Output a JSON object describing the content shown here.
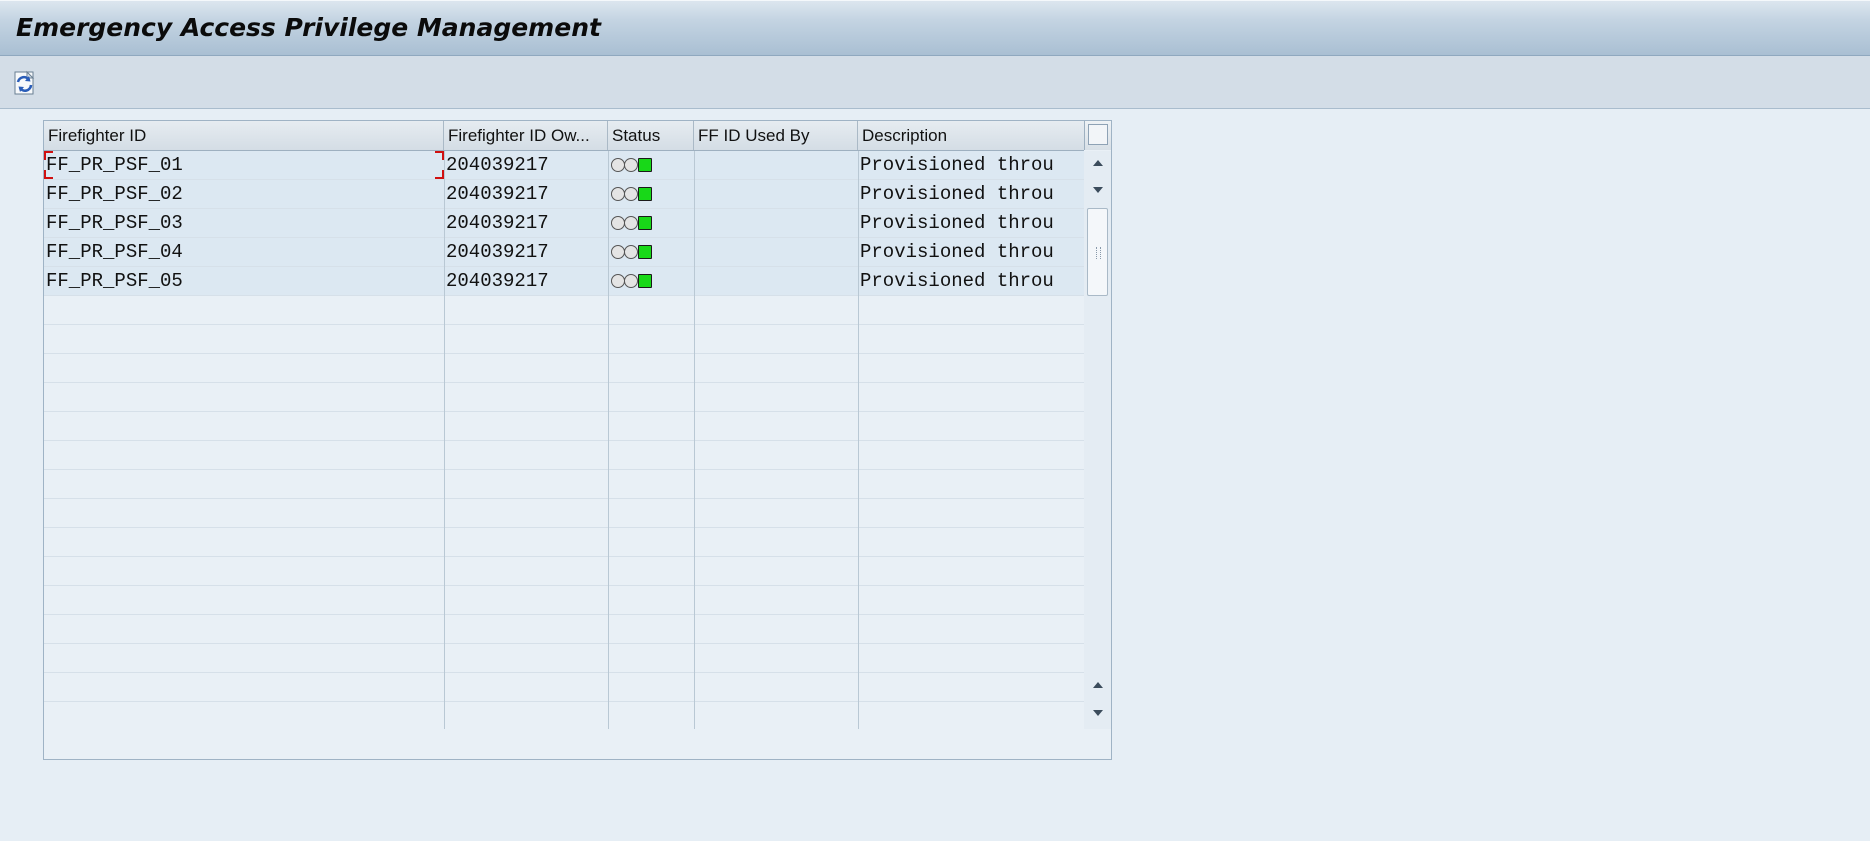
{
  "app": {
    "title": "Emergency Access Privilege Management"
  },
  "toolbar": {
    "refresh_icon": "refresh-icon"
  },
  "table": {
    "columns": [
      "Firefighter ID",
      "Firefighter ID Ow...",
      "Status",
      "FF ID Used By",
      "Description"
    ],
    "rows": [
      {
        "ff_id": "FF_PR_PSF_01",
        "owner": "204039217",
        "status": "green",
        "used_by": "",
        "description": "Provisioned throu"
      },
      {
        "ff_id": "FF_PR_PSF_02",
        "owner": "204039217",
        "status": "green",
        "used_by": "",
        "description": "Provisioned throu"
      },
      {
        "ff_id": "FF_PR_PSF_03",
        "owner": "204039217",
        "status": "green",
        "used_by": "",
        "description": "Provisioned throu"
      },
      {
        "ff_id": "FF_PR_PSF_04",
        "owner": "204039217",
        "status": "green",
        "used_by": "",
        "description": "Provisioned throu"
      },
      {
        "ff_id": "FF_PR_PSF_05",
        "owner": "204039217",
        "status": "green",
        "used_by": "",
        "description": "Provisioned throu"
      }
    ],
    "empty_row_count": 15
  },
  "colors": {
    "status_green": "#18d818",
    "focus_marker": "#d01010"
  }
}
